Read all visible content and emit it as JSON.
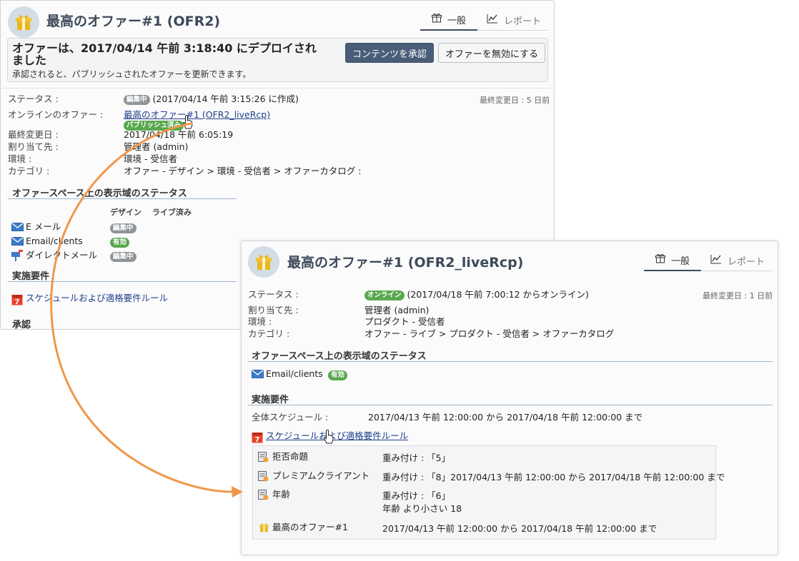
{
  "colors": {
    "accent": "#3e4a5a",
    "primary_button": "#4a5d78",
    "badge_gray": "#8f9499",
    "badge_green": "#59a84f",
    "link": "#1e3f8a",
    "arrow": "#f0974a"
  },
  "panel_a": {
    "title": "最高のオファー#1 (OFR2)",
    "header_icon": "gift-icon",
    "tabs": [
      {
        "label": "一般",
        "icon": "gift-icon",
        "active": true
      },
      {
        "label": "レポート",
        "icon": "chart-line-icon",
        "active": false
      }
    ],
    "alert": {
      "title": "オファーは、2017/04/14 午前 3:18:40 にデプロイされました",
      "subtitle": "承認されると、パブリッシュされたオファーを更新できます。",
      "approve_button": "コンテンツを承認",
      "disable_button": "オファーを無効にする"
    },
    "last_modified_note": "最終変更日 : 5 日前",
    "fields": {
      "status_label": "ステータス :",
      "status_badge": "編集中",
      "status_value": "(2017/04/14 午前 3:15:26 に作成)",
      "online_offer_label": "オンラインのオファー :",
      "online_offer_link": "最高のオファー#1 (OFR2_liveRcp)",
      "online_offer_badge": "パブリッシュ済み",
      "last_modified_label": "最終変更日 :",
      "last_modified_value": "2017/04/18 午前 6:05:19",
      "assignee_label": "割り当て先 :",
      "assignee_value": "管理者 (admin)",
      "environment_label": "環境 :",
      "environment_value": "環境 - 受信者",
      "category_label": "カテゴリ :",
      "category_value": "オファー - デザイン > 環境 - 受信者 > オファーカタログ :"
    },
    "space_section": {
      "title": "オファースペース上の表示域のステータス",
      "col_design": "デザイン",
      "col_live": "ライブ済み",
      "rows": [
        {
          "icon": "email-icon",
          "label": "E メール",
          "badge": "編集中"
        },
        {
          "icon": "email-icon",
          "label": "Email/clients",
          "badge": "有効"
        },
        {
          "icon": "direct-mail-icon",
          "label": "ダイレクトメール",
          "badge": "編集中"
        }
      ]
    },
    "requirements_title": "実施要件",
    "schedule_link": "スケジュールおよび適格要件ルール",
    "approval_title": "承認"
  },
  "panel_b": {
    "title": "最高のオファー#1 (OFR2_liveRcp)",
    "header_icon": "gift-icon",
    "tabs": [
      {
        "label": "一般",
        "icon": "gift-icon",
        "active": true
      },
      {
        "label": "レポート",
        "icon": "chart-line-icon",
        "active": false
      }
    ],
    "last_modified_note": "最終変更日 : 1 日前",
    "fields": {
      "status_label": "ステータス :",
      "status_badge": "オンライン",
      "status_value": "(2017/04/18 午前 7:00:12 からオンライン)",
      "assignee_label": "割り当て先 :",
      "assignee_value": "管理者 (admin)",
      "environment_label": "環境 :",
      "environment_value": "プロダクト - 受信者",
      "category_label": "カテゴリ :",
      "category_value": "オファー - ライブ > プロダクト - 受信者 > オファーカタログ"
    },
    "space_section": {
      "title": "オファースペース上の表示域のステータス",
      "rows": [
        {
          "icon": "email-icon",
          "label": "Email/clients",
          "badge": "有効"
        }
      ]
    },
    "requirements": {
      "title": "実施要件",
      "schedule_label": "全体スケジュール :",
      "schedule_value": "2017/04/13 午前 12:00:00 から 2017/04/18 午前 12:00:00 まで",
      "rules_link": "スケジュールおよび適格要件ルール",
      "rules": [
        {
          "icon": "rule-icon",
          "name": "拒否命題",
          "detail": "重み付け : 「5」",
          "detail2": ""
        },
        {
          "icon": "rule-icon",
          "name": "プレミアムクライアント",
          "detail": "重み付け : 「8」2017/04/13 午前 12:00:00 から 2017/04/18 午前 12:00:00 まで",
          "detail2": ""
        },
        {
          "icon": "rule-icon",
          "name": "年齢",
          "detail": "重み付け : 「6」",
          "detail2": "年齢 より小さい 18"
        },
        {
          "icon": "gift-icon",
          "name": "最高のオファー#1",
          "detail": "2017/04/13 午前 12:00:00 から 2017/04/18 午前 12:00:00 まで",
          "detail2": ""
        }
      ]
    }
  }
}
